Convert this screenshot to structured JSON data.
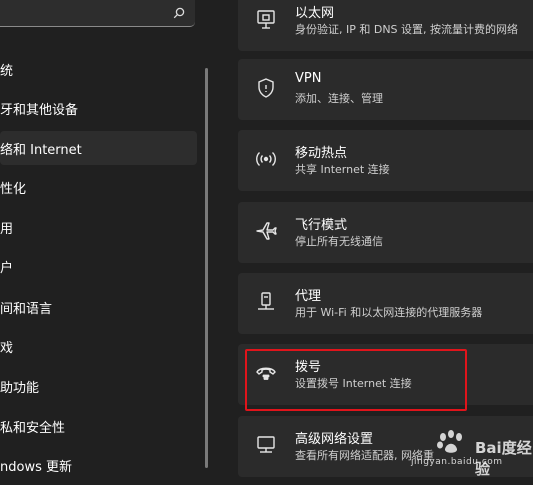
{
  "sidebar": {
    "search_icon": "search-icon",
    "items": [
      {
        "label": "统"
      },
      {
        "label": "牙和其他设备"
      },
      {
        "label": "络和 Internet"
      },
      {
        "label": "性化"
      },
      {
        "label": "用"
      },
      {
        "label": "户"
      },
      {
        "label": "间和语言"
      },
      {
        "label": "戏"
      },
      {
        "label": "助功能"
      },
      {
        "label": "私和安全性"
      },
      {
        "label": "ndows 更新"
      }
    ]
  },
  "cards": [
    {
      "icon": "ethernet-icon",
      "title": "以太网",
      "subtitle": "身份验证, IP 和 DNS 设置, 按流量计费的网络"
    },
    {
      "icon": "shield-icon",
      "title": "VPN",
      "subtitle": "添加、连接、管理"
    },
    {
      "icon": "hotspot-icon",
      "title": "移动热点",
      "subtitle": "共享 Internet 连接"
    },
    {
      "icon": "airplane-icon",
      "title": "飞行模式",
      "subtitle": "停止所有无线通信"
    },
    {
      "icon": "proxy-icon",
      "title": "代理",
      "subtitle": "用于 Wi-Fi 和以太网连接的代理服务器"
    },
    {
      "icon": "dialup-icon",
      "title": "拨号",
      "subtitle": "设置拨号 Internet 连接"
    },
    {
      "icon": "advanced-network-icon",
      "title": "高级网络设置",
      "subtitle": "查看所有网络适配器, 网络重"
    }
  ],
  "watermark": {
    "brand": "Bai度经验",
    "url": "jingyan.baidu.com"
  },
  "colors": {
    "background": "#202020",
    "card": "#2b2b2b",
    "highlight": "#e0141b"
  }
}
